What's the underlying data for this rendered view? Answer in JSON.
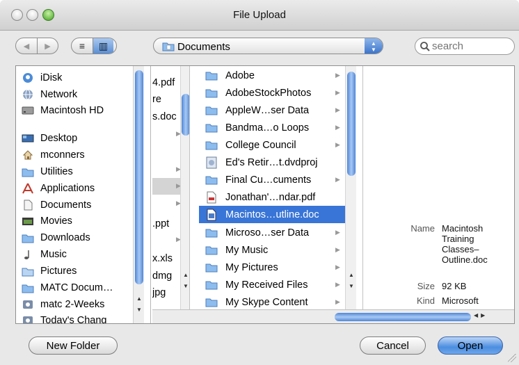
{
  "window": {
    "title": "File Upload"
  },
  "toolbar": {
    "back_glyph": "◀",
    "forward_glyph": "▶",
    "list_view_glyph": "≡",
    "column_view_glyph": "▥",
    "location": "Documents",
    "search_placeholder": "search"
  },
  "sidebar": {
    "items": [
      {
        "label": "iDisk",
        "icon": "idisk-icon"
      },
      {
        "label": "Network",
        "icon": "network-icon"
      },
      {
        "label": "Macintosh HD",
        "icon": "hard-drive-icon"
      },
      {
        "label": "Desktop",
        "icon": "desktop-icon"
      },
      {
        "label": "mconners",
        "icon": "home-icon"
      },
      {
        "label": "Utilities",
        "icon": "folder-icon"
      },
      {
        "label": "Applications",
        "icon": "applications-icon"
      },
      {
        "label": "Documents",
        "icon": "documents-icon"
      },
      {
        "label": "Movies",
        "icon": "movies-icon"
      },
      {
        "label": "Downloads",
        "icon": "folder-icon"
      },
      {
        "label": "Music",
        "icon": "music-icon"
      },
      {
        "label": "Pictures",
        "icon": "pictures-icon"
      },
      {
        "label": "MATC Docum…",
        "icon": "folder-icon"
      },
      {
        "label": "matc 2-Weeks",
        "icon": "smart-folder-icon"
      },
      {
        "label": "Today's Chang",
        "icon": "smart-folder-icon"
      }
    ]
  },
  "column1": {
    "items": [
      "4.pdf",
      "re",
      "s.doc",
      "",
      "",
      "",
      "",
      "",
      ".ppt",
      "",
      "x.xls",
      "dmg",
      "jpg"
    ]
  },
  "column2": {
    "items": [
      {
        "label": "Adobe",
        "icon": "folder-icon",
        "arrow": "▶"
      },
      {
        "label": "AdobeStockPhotos",
        "icon": "folder-icon",
        "arrow": "▶"
      },
      {
        "label": "AppleW…ser Data",
        "icon": "folder-icon",
        "arrow": "▶"
      },
      {
        "label": "Bandma…o Loops",
        "icon": "folder-icon",
        "arrow": "▶"
      },
      {
        "label": "College Council",
        "icon": "folder-icon",
        "arrow": "▶"
      },
      {
        "label": "Ed's Retir…t.dvdproj",
        "icon": "dvdproj-icon",
        "arrow": ""
      },
      {
        "label": "Final Cu…cuments",
        "icon": "folder-icon",
        "arrow": "▶"
      },
      {
        "label": "Jonathan'…ndar.pdf",
        "icon": "pdf-icon",
        "arrow": ""
      },
      {
        "label": "Macintos…utline.doc",
        "icon": "doc-icon",
        "arrow": "",
        "selected": true
      },
      {
        "label": "Microso…ser Data",
        "icon": "folder-icon",
        "arrow": "▶"
      },
      {
        "label": "My Music",
        "icon": "folder-icon",
        "arrow": "▶"
      },
      {
        "label": "My Pictures",
        "icon": "folder-icon",
        "arrow": "▶"
      },
      {
        "label": "My Received Files",
        "icon": "folder-icon",
        "arrow": "▶"
      },
      {
        "label": "My Skype Content",
        "icon": "folder-icon",
        "arrow": "▶"
      }
    ]
  },
  "preview": {
    "name_key": "Name",
    "name_lines": [
      "Macintosh",
      "Training",
      "Classes–",
      "Outline.doc"
    ],
    "size_key": "Size",
    "size_value": "92 KB",
    "kind_key": "Kind",
    "kind_value": "Microsoft"
  },
  "buttons": {
    "new_folder": "New Folder",
    "cancel": "Cancel",
    "open": "Open"
  },
  "colors": {
    "selection": "#3875d7",
    "scroll_thumb": "#4f86d9",
    "folder": "#7fb3ea"
  }
}
